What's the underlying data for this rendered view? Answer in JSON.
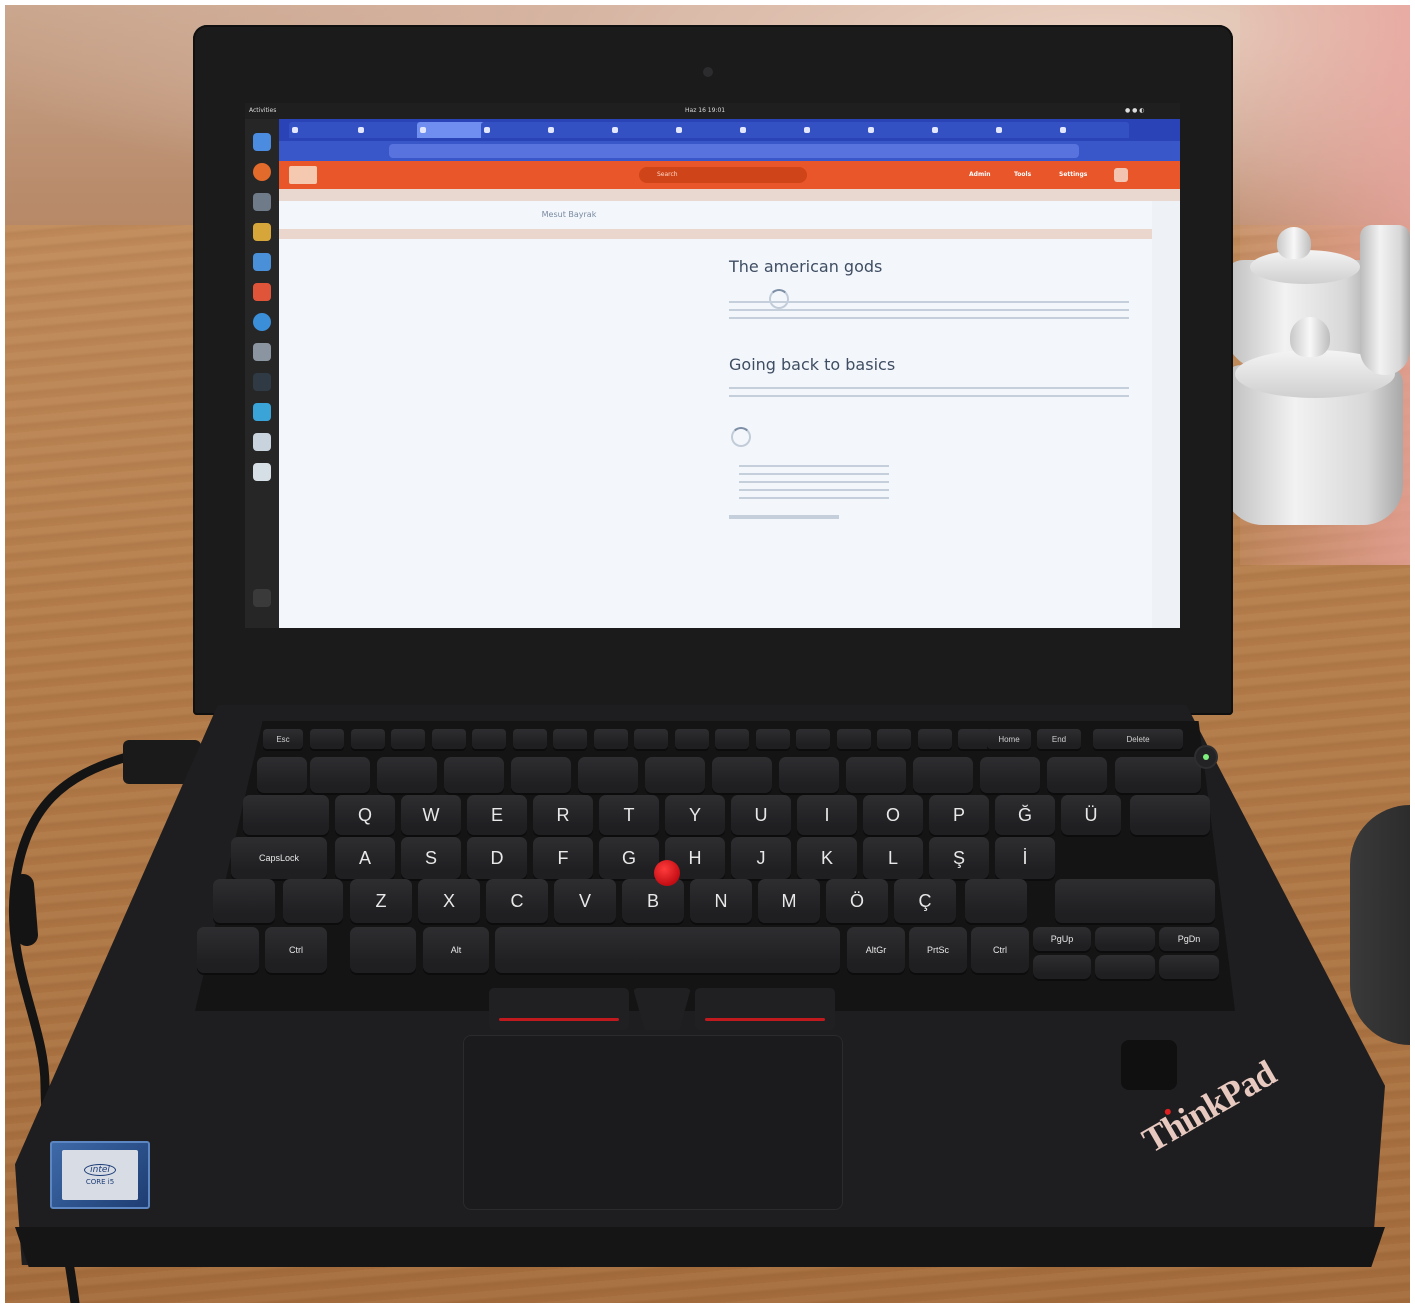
{
  "photo": {
    "subject": "laptop-on-wooden-table",
    "colors": {
      "wood": "#b07c56",
      "laptop": "#1e1e20",
      "screen": "#eaf0f7",
      "site_accent": "#e8562a",
      "browser_tabs": "#2a44b8",
      "trackpoint": "#d01a1f"
    }
  },
  "desktop": {
    "activities": "Activities",
    "clock": "Haz 16 19:01"
  },
  "site": {
    "search_placeholder": "Search",
    "page_title": "Mesut Bayrak",
    "nav": [
      "Admin",
      "Tools",
      "Settings"
    ]
  },
  "preview": {
    "post1_title": "The american gods",
    "post2_title": "Going back to basics"
  },
  "keyboard": {
    "fn_row": [
      "Esc",
      "Home",
      "End",
      "Delete"
    ],
    "row_q": [
      "Q",
      "W",
      "E",
      "R",
      "T",
      "Y",
      "U",
      "I",
      "O",
      "P",
      "Ğ",
      "Ü"
    ],
    "row_a": [
      "A",
      "S",
      "D",
      "F",
      "G",
      "H",
      "J",
      "K",
      "L",
      "Ş",
      "İ"
    ],
    "row_z": [
      "Z",
      "X",
      "C",
      "V",
      "B",
      "N",
      "M",
      "Ö",
      "Ç"
    ],
    "capslock": "CapsLock",
    "ctrl_left": "Ctrl",
    "alt": "Alt",
    "altgr": "AltGr",
    "prtsc": "PrtSc",
    "ctrl_right": "Ctrl",
    "pgup": "PgUp",
    "pgdn": "PgDn"
  },
  "branding": {
    "thinkpad": "ThinkPad",
    "intel_line1": "intel",
    "intel_line2": "CORE i5"
  }
}
